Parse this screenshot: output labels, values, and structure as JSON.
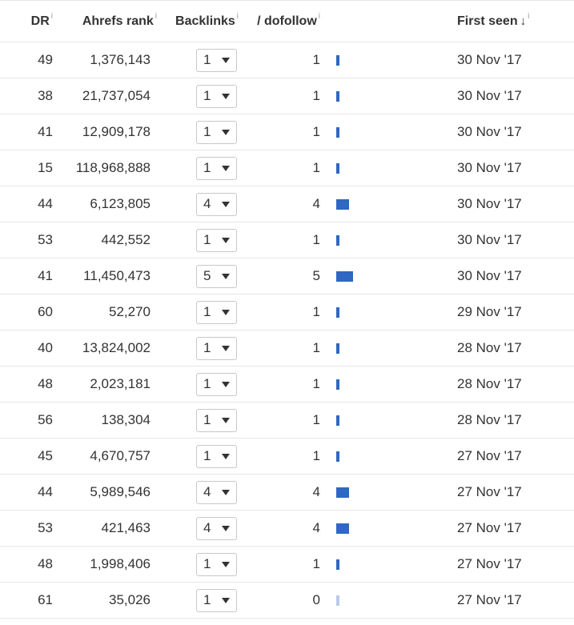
{
  "headers": {
    "dr": "DR",
    "ahrefs_rank": "Ahrefs rank",
    "backlinks": "Backlinks",
    "dofollow": "/ dofollow",
    "first_seen": "First seen",
    "info_marker": "i",
    "sort_marker": "↓"
  },
  "colors": {
    "bar_dofollow": "#2f67c2",
    "bar_zero": "#b9cbe8"
  },
  "rows": [
    {
      "dr": "49",
      "rank": "1,376,143",
      "backlinks": "1",
      "dofollow": "1",
      "first_seen": "30 Nov '17"
    },
    {
      "dr": "38",
      "rank": "21,737,054",
      "backlinks": "1",
      "dofollow": "1",
      "first_seen": "30 Nov '17"
    },
    {
      "dr": "41",
      "rank": "12,909,178",
      "backlinks": "1",
      "dofollow": "1",
      "first_seen": "30 Nov '17"
    },
    {
      "dr": "15",
      "rank": "118,968,888",
      "backlinks": "1",
      "dofollow": "1",
      "first_seen": "30 Nov '17"
    },
    {
      "dr": "44",
      "rank": "6,123,805",
      "backlinks": "4",
      "dofollow": "4",
      "first_seen": "30 Nov '17"
    },
    {
      "dr": "53",
      "rank": "442,552",
      "backlinks": "1",
      "dofollow": "1",
      "first_seen": "30 Nov '17"
    },
    {
      "dr": "41",
      "rank": "11,450,473",
      "backlinks": "5",
      "dofollow": "5",
      "first_seen": "30 Nov '17"
    },
    {
      "dr": "60",
      "rank": "52,270",
      "backlinks": "1",
      "dofollow": "1",
      "first_seen": "29 Nov '17"
    },
    {
      "dr": "40",
      "rank": "13,824,002",
      "backlinks": "1",
      "dofollow": "1",
      "first_seen": "28 Nov '17"
    },
    {
      "dr": "48",
      "rank": "2,023,181",
      "backlinks": "1",
      "dofollow": "1",
      "first_seen": "28 Nov '17"
    },
    {
      "dr": "56",
      "rank": "138,304",
      "backlinks": "1",
      "dofollow": "1",
      "first_seen": "28 Nov '17"
    },
    {
      "dr": "45",
      "rank": "4,670,757",
      "backlinks": "1",
      "dofollow": "1",
      "first_seen": "27 Nov '17"
    },
    {
      "dr": "44",
      "rank": "5,989,546",
      "backlinks": "4",
      "dofollow": "4",
      "first_seen": "27 Nov '17"
    },
    {
      "dr": "53",
      "rank": "421,463",
      "backlinks": "4",
      "dofollow": "4",
      "first_seen": "27 Nov '17"
    },
    {
      "dr": "48",
      "rank": "1,998,406",
      "backlinks": "1",
      "dofollow": "1",
      "first_seen": "27 Nov '17"
    },
    {
      "dr": "61",
      "rank": "35,026",
      "backlinks": "1",
      "dofollow": "0",
      "first_seen": "27 Nov '17"
    }
  ]
}
